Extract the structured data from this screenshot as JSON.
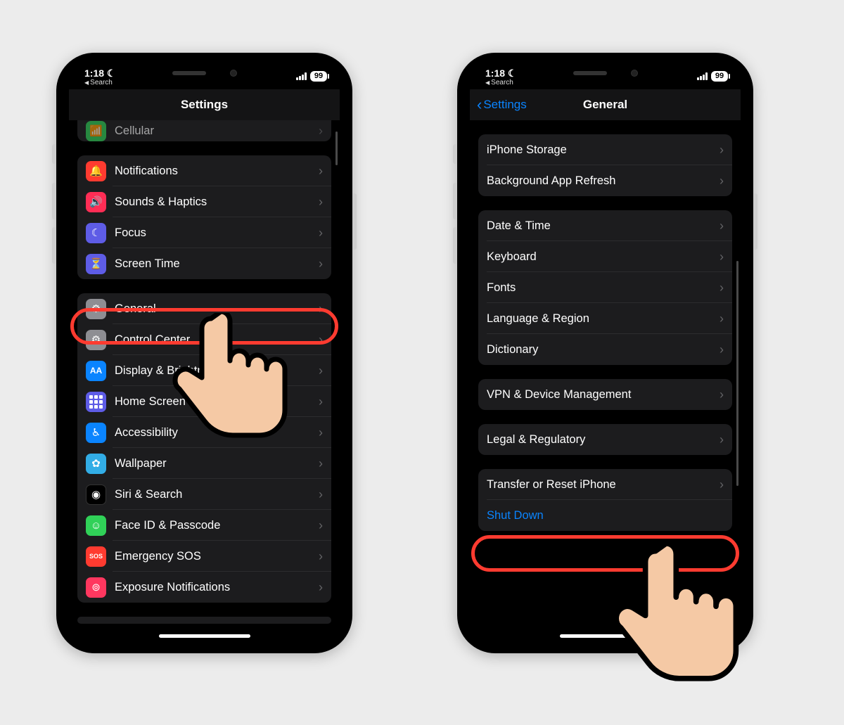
{
  "status": {
    "time": "1:18",
    "back_label": "Search",
    "battery": "99"
  },
  "left": {
    "title": "Settings",
    "partial_row": {
      "label": "Cellular"
    },
    "group_a": [
      {
        "label": "Notifications",
        "icon": "bell",
        "bg": "bg-red"
      },
      {
        "label": "Sounds & Haptics",
        "icon": "speaker",
        "bg": "bg-pink"
      },
      {
        "label": "Focus",
        "icon": "moon",
        "bg": "bg-indigo"
      },
      {
        "label": "Screen Time",
        "icon": "hourglass",
        "bg": "bg-indigo"
      }
    ],
    "group_b": [
      {
        "label": "General",
        "icon": "gear",
        "bg": "bg-gray"
      },
      {
        "label": "Control Center",
        "icon": "switches",
        "bg": "bg-gray"
      },
      {
        "label": "Display & Brightness",
        "icon": "AA",
        "bg": "bg-blue",
        "text_icon": "AA"
      },
      {
        "label": "Home Screen",
        "icon": "grid",
        "bg": "bg-indigo"
      },
      {
        "label": "Accessibility",
        "icon": "person",
        "bg": "bg-blue"
      },
      {
        "label": "Wallpaper",
        "icon": "flower",
        "bg": "bg-teal"
      },
      {
        "label": "Siri & Search",
        "icon": "siri",
        "bg": "bg-black"
      },
      {
        "label": "Face ID & Passcode",
        "icon": "faceid",
        "bg": "bg-green"
      },
      {
        "label": "Emergency SOS",
        "icon": "sos",
        "bg": "bg-sos",
        "text_icon": "SOS"
      },
      {
        "label": "Exposure Notifications",
        "icon": "exposure",
        "bg": "bg-pinkdot"
      }
    ]
  },
  "right": {
    "back": "Settings",
    "title": "General",
    "group_a": [
      {
        "label": "iPhone Storage"
      },
      {
        "label": "Background App Refresh"
      }
    ],
    "group_b": [
      {
        "label": "Date & Time"
      },
      {
        "label": "Keyboard"
      },
      {
        "label": "Fonts"
      },
      {
        "label": "Language & Region"
      },
      {
        "label": "Dictionary"
      }
    ],
    "group_c": [
      {
        "label": "VPN & Device Management"
      }
    ],
    "group_d": [
      {
        "label": "Legal & Regulatory"
      }
    ],
    "group_e": [
      {
        "label": "Transfer or Reset iPhone",
        "chev": true
      },
      {
        "label": "Shut Down",
        "blue": true
      }
    ]
  }
}
